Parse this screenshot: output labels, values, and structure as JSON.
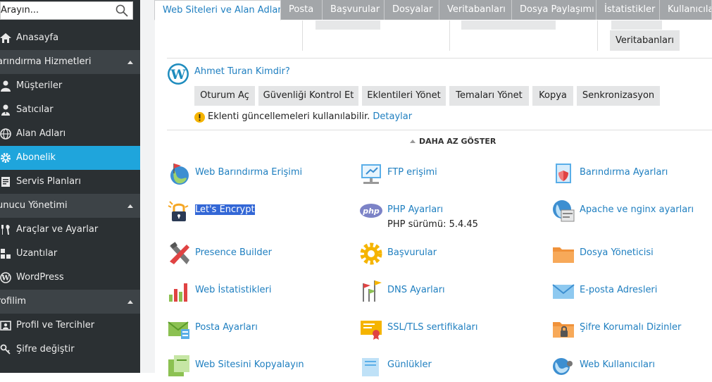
{
  "search": {
    "placeholder": "Arayın..."
  },
  "sidebar": {
    "items": [
      {
        "label": "Anasayfa"
      },
      {
        "label": "Barındırma Hizmetleri",
        "group": true
      },
      {
        "label": "Müşteriler"
      },
      {
        "label": "Satıcılar"
      },
      {
        "label": "Alan Adları"
      },
      {
        "label": "Abonelik",
        "active": true
      },
      {
        "label": "Servis Planları"
      },
      {
        "label": "Sunucu Yönetimi",
        "group": true
      },
      {
        "label": "Araçlar ve Ayarlar"
      },
      {
        "label": "Uzantılar"
      },
      {
        "label": "WordPress"
      },
      {
        "label": "Profilim",
        "group": true
      },
      {
        "label": "Profil ve Tercihler"
      },
      {
        "label": "Şifre değiştir"
      }
    ],
    "visible_labels": {
      "g1": "arındırma Hizmetleri",
      "g2": "unucu Yönetimi",
      "g3": "rofilim"
    }
  },
  "tabs": [
    {
      "label": "Web Siteleri ve Alan Adları",
      "active": true
    },
    {
      "label": "Posta"
    },
    {
      "label": "Başvurular"
    },
    {
      "label": "Dosyalar"
    },
    {
      "label": "Veritabanları"
    },
    {
      "label": "Dosya Paylaşımı"
    },
    {
      "label": "İstatistikler"
    },
    {
      "label": "Kullanıcılar"
    }
  ],
  "top_strip": {
    "database_button": "Veritabanları"
  },
  "wordpress": {
    "site_link": "Ahmet Turan Kimdir?",
    "buttons": [
      "Oturum Aç",
      "Güvenliği Kontrol Et",
      "Eklentileri Yönet",
      "Temaları Yönet",
      "Kopya",
      "Senkronizasyon"
    ],
    "notice_text": "Eklenti güncellemeleri kullanılabilir.",
    "notice_link": "Detaylar"
  },
  "show_less": "DAHA AZ GÖSTER",
  "tools": [
    {
      "label": "Web Barındırma Erişimi",
      "icon": "globe-flag-icon"
    },
    {
      "label": "FTP erişimi",
      "icon": "ftp-icon"
    },
    {
      "label": "Barındırma Ayarları",
      "icon": "hosting-settings-icon"
    },
    {
      "label": "Let's Encrypt",
      "icon": "lets-encrypt-icon",
      "selected": true
    },
    {
      "label": "PHP Ayarları",
      "icon": "php-icon",
      "sub": "PHP sürümü: 5.4.45"
    },
    {
      "label": "Apache ve nginx ayarları",
      "icon": "apache-nginx-icon"
    },
    {
      "label": "Presence Builder",
      "icon": "presence-builder-icon"
    },
    {
      "label": "Başvurular",
      "icon": "applications-gear-icon"
    },
    {
      "label": "Dosya Yöneticisi",
      "icon": "folder-icon"
    },
    {
      "label": "Web İstatistikleri",
      "icon": "statistics-icon"
    },
    {
      "label": "DNS Ayarları",
      "icon": "dns-icon"
    },
    {
      "label": "E-posta Adresleri",
      "icon": "envelope-icon"
    },
    {
      "label": "Posta Ayarları",
      "icon": "mail-settings-icon"
    },
    {
      "label": "SSL/TLS sertifikaları",
      "icon": "certificate-icon"
    },
    {
      "label": "Şifre Korumalı Dizinler",
      "icon": "protected-folder-icon"
    },
    {
      "label": "Web Sitesini Kopyalayın",
      "icon": "copy-site-icon"
    },
    {
      "label": "Günlükler",
      "icon": "logs-icon"
    },
    {
      "label": "Web Kullanıcıları",
      "icon": "web-users-icon"
    }
  ],
  "colors": {
    "sidebar": "#2b3033",
    "active": "#1fa5dc",
    "link": "#1f7fc0",
    "tab": "#a3a6a9"
  }
}
